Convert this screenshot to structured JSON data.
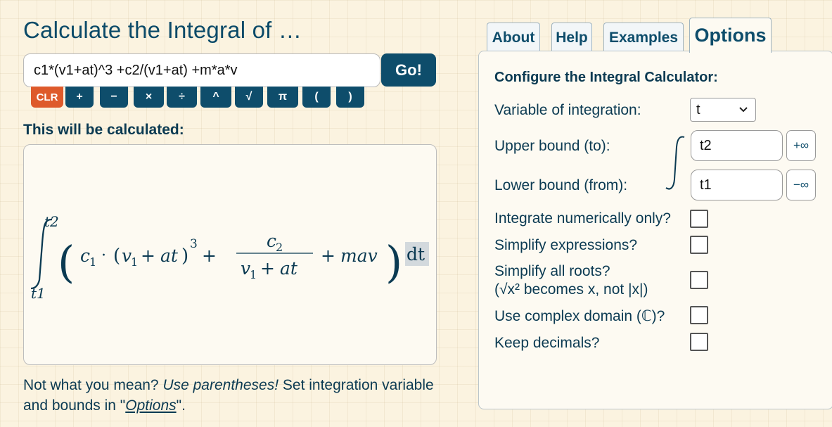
{
  "title": "Calculate the Integral of …",
  "expression": {
    "value": "c1*(v1+at)^3 +c2/(v1+at) +m*a*v",
    "go_label": "Go!"
  },
  "keypad": [
    "CLR",
    "+",
    "−",
    "×",
    "÷",
    "^",
    "√",
    "π",
    "(",
    ")"
  ],
  "preview_heading": "This will be calculated:",
  "formula": {
    "upper": "t2",
    "lower": "t1",
    "c1": "c",
    "c1_sub": "1",
    "dot": "·",
    "v1": "v",
    "v1_sub": "1",
    "at": "at",
    "plus": "+",
    "cube": "3",
    "c2": "c",
    "c2_sub": "2",
    "mav": "mav",
    "open_paren": "(",
    "close_paren": ")",
    "dt": "dt"
  },
  "hint": {
    "part1": "Not what you mean? ",
    "part2": "Use parentheses!",
    "part3": " Set integration variable and bounds in \"",
    "link": "Options",
    "part4": "\"."
  },
  "tabs": [
    {
      "label": "About",
      "active": false
    },
    {
      "label": "Help",
      "active": false
    },
    {
      "label": "Examples",
      "active": false
    },
    {
      "label": "Options",
      "active": true
    }
  ],
  "options": {
    "heading": "Configure the Integral Calculator:",
    "variable_label": "Variable of integration:",
    "variable_value": "t",
    "upper_label": "Upper bound (to):",
    "upper_value": "t2",
    "upper_inf": "+∞",
    "lower_label": "Lower bound (from):",
    "lower_value": "t1",
    "lower_inf": "−∞",
    "numeric_label": "Integrate numerically only?",
    "simplify_label": "Simplify expressions?",
    "roots_label": "Simplify all roots?",
    "roots_note": "(√x² becomes x, not |x|)",
    "complex_label": "Use complex domain (ℂ)?",
    "decimals_label": "Keep decimals?"
  },
  "colors": {
    "accent": "#0e4d6b",
    "clear": "#de5a2b",
    "background": "#fbf3e0"
  }
}
